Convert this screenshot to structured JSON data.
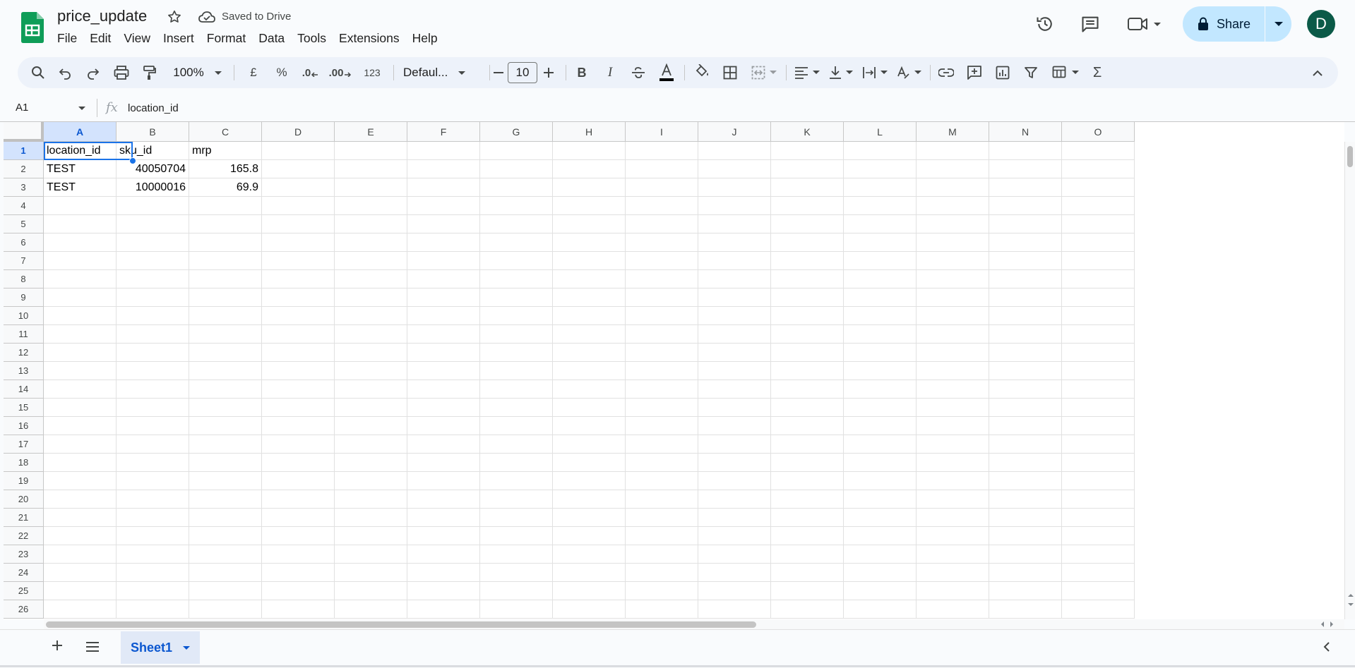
{
  "app": {
    "title": "price_update",
    "save_status": "Saved to Drive",
    "user_initial": "D",
    "accent": "#0b57d0",
    "logo_color": "#0f9d58"
  },
  "menu": [
    "File",
    "Edit",
    "View",
    "Insert",
    "Format",
    "Data",
    "Tools",
    "Extensions",
    "Help"
  ],
  "header_icons": [
    "history-icon",
    "comments-icon",
    "meet-icon"
  ],
  "share": {
    "label": "Share"
  },
  "toolbar": {
    "zoom": "100%",
    "currency": "£",
    "percent": "%",
    "decrease_decimal": ".0",
    "increase_decimal": ".00",
    "number_format": "123",
    "font": "Defaul...",
    "font_size": "10"
  },
  "formula_bar": {
    "name_box": "A1",
    "fx": "fx",
    "content": "location_id"
  },
  "grid": {
    "columns": [
      "A",
      "B",
      "C",
      "D",
      "E",
      "F",
      "G",
      "H",
      "I",
      "J",
      "K",
      "L",
      "M",
      "N",
      "O"
    ],
    "rows": [
      "1",
      "2",
      "3",
      "4",
      "5",
      "6",
      "7",
      "8",
      "9",
      "10",
      "11",
      "12",
      "13",
      "14",
      "15",
      "16",
      "17",
      "18",
      "19",
      "20",
      "21",
      "22",
      "23",
      "24",
      "25",
      "26"
    ],
    "selected_cell": "A1",
    "cells": {
      "A1": "location_id",
      "B1": "sku_id",
      "C1": "mrp",
      "A2": "TEST",
      "B2": "40050704",
      "C2": "165.8",
      "A3": "TEST",
      "B3": "10000016",
      "C3": "69.9"
    }
  },
  "sheets": {
    "active": "Sheet1"
  }
}
